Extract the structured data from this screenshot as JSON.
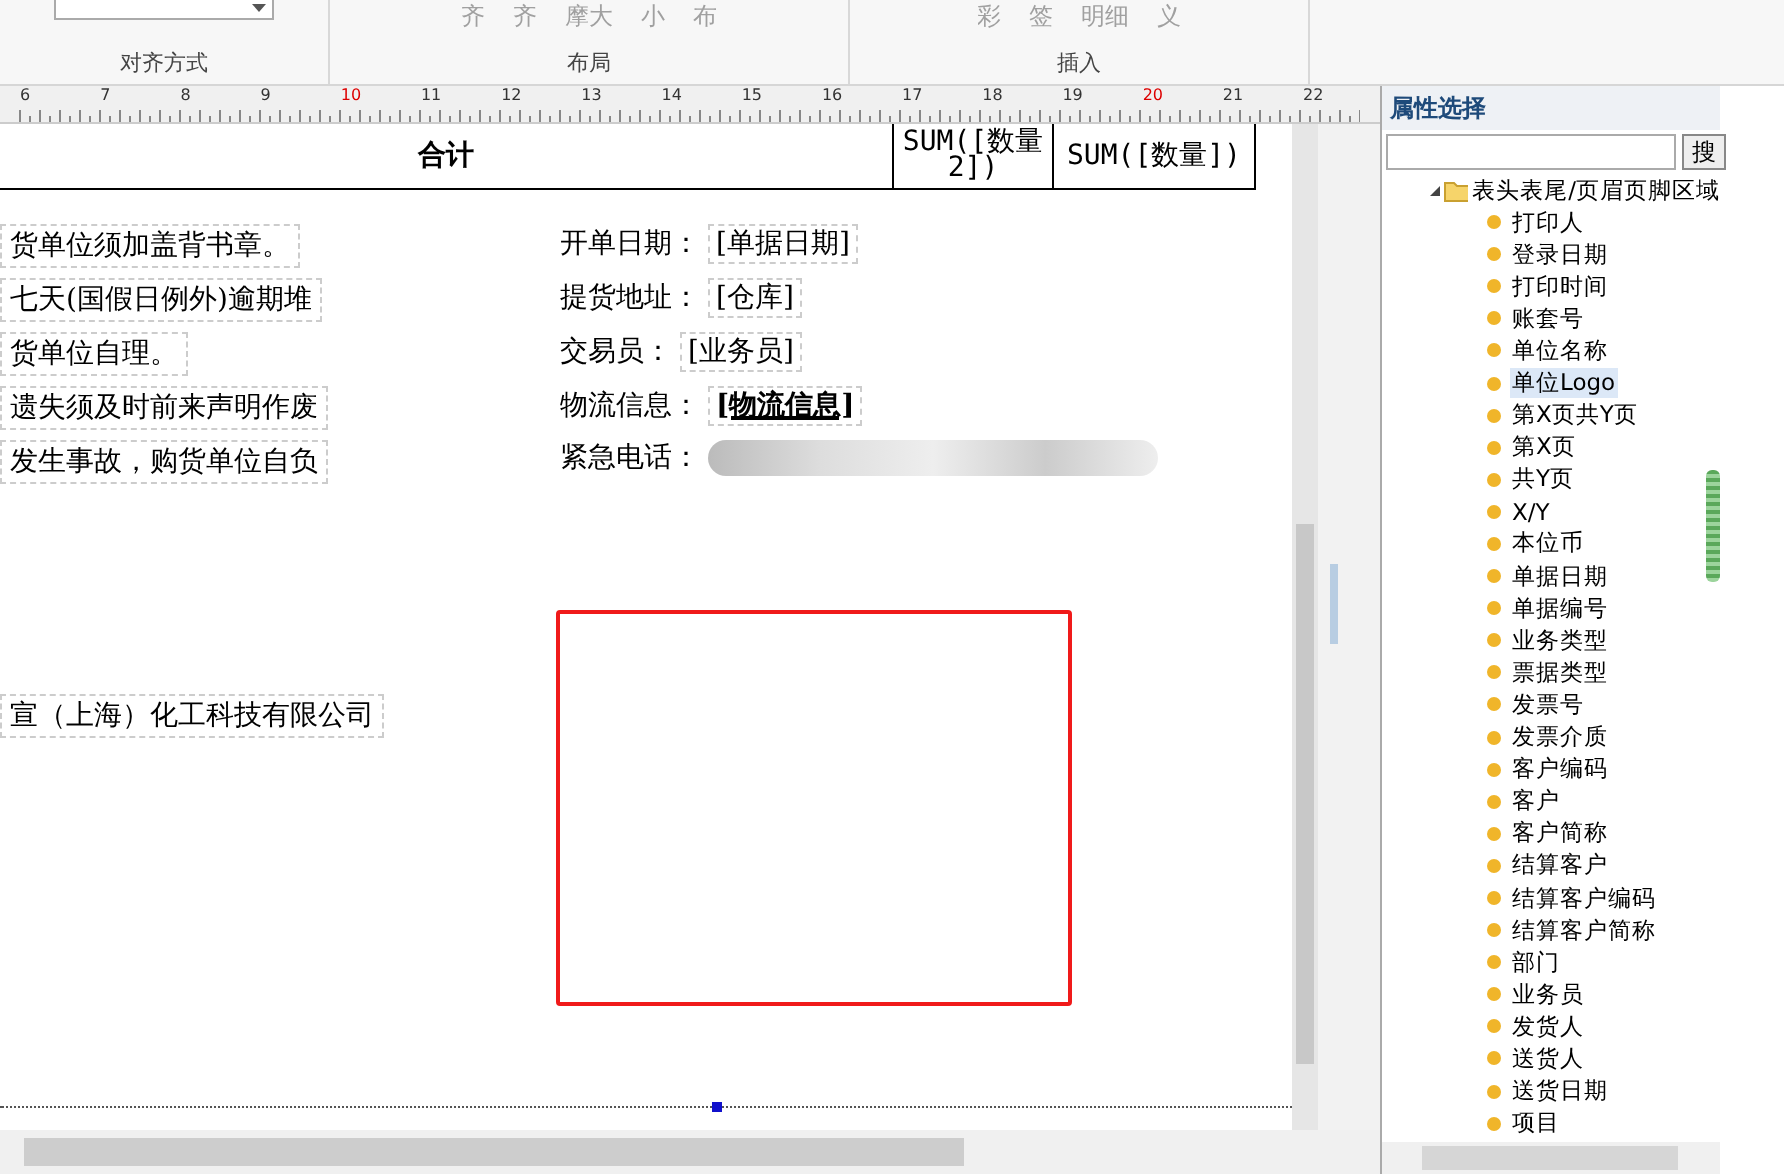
{
  "ribbon": {
    "groups": [
      {
        "label": "对齐方式",
        "kind": "dropdown"
      },
      {
        "label": "布局",
        "kind": "buttons",
        "fragments": [
          "齐",
          "齐",
          "摩大",
          "小",
          "布"
        ]
      },
      {
        "label": "插入",
        "kind": "buttons",
        "fragments": [
          "彩",
          "签",
          "明细",
          "义"
        ]
      }
    ]
  },
  "ruler": {
    "ticks": [
      {
        "label": "6",
        "marked": false
      },
      {
        "label": "7",
        "marked": false
      },
      {
        "label": "8",
        "marked": false
      },
      {
        "label": "9",
        "marked": false
      },
      {
        "label": "10",
        "marked": true
      },
      {
        "label": "11",
        "marked": false
      },
      {
        "label": "12",
        "marked": false
      },
      {
        "label": "13",
        "marked": false
      },
      {
        "label": "14",
        "marked": false
      },
      {
        "label": "15",
        "marked": false
      },
      {
        "label": "16",
        "marked": false
      },
      {
        "label": "17",
        "marked": false
      },
      {
        "label": "18",
        "marked": false
      },
      {
        "label": "19",
        "marked": false
      },
      {
        "label": "20",
        "marked": true
      },
      {
        "label": "21",
        "marked": false
      },
      {
        "label": "22",
        "marked": false
      }
    ]
  },
  "total_row": {
    "label": "合计",
    "cells": [
      "SUM([数量2])",
      "SUM([数量])"
    ]
  },
  "notes": [
    "货单位须加盖背书章。",
    "七天(国假日例外)逾期堆",
    "货单位自理。",
    "遗失须及时前来声明作废",
    "发生事故，购货单位自负"
  ],
  "fields": [
    {
      "kind": "text",
      "label": "开单日期：",
      "value": "[单据日期]",
      "underlined": false
    },
    {
      "kind": "text",
      "label": "提货地址：",
      "value": "[仓库]",
      "underlined": false
    },
    {
      "kind": "text",
      "label": "交易员：",
      "value": "[业务员]",
      "underlined": false
    },
    {
      "kind": "text",
      "label": "物流信息：",
      "value": "[物流信息]",
      "underlined": true
    },
    {
      "kind": "blurred",
      "label": "紧急电话："
    }
  ],
  "company": "宣（上海）化工科技有限公司",
  "panel": {
    "title": "属性选择",
    "search_button": "搜",
    "tree": {
      "label": "表头表尾/页眉页脚区域",
      "expanded": true,
      "children": [
        {
          "label": "打印人",
          "selected": false
        },
        {
          "label": "登录日期",
          "selected": false
        },
        {
          "label": "打印时间",
          "selected": false
        },
        {
          "label": "账套号",
          "selected": false
        },
        {
          "label": "单位名称",
          "selected": false
        },
        {
          "label": "单位Logo",
          "selected": true
        },
        {
          "label": "第X页共Y页",
          "selected": false
        },
        {
          "label": "第X页",
          "selected": false
        },
        {
          "label": "共Y页",
          "selected": false
        },
        {
          "label": "X/Y",
          "selected": false
        },
        {
          "label": "本位币",
          "selected": false
        },
        {
          "label": "单据日期",
          "selected": false
        },
        {
          "label": "单据编号",
          "selected": false
        },
        {
          "label": "业务类型",
          "selected": false
        },
        {
          "label": "票据类型",
          "selected": false
        },
        {
          "label": "发票号",
          "selected": false
        },
        {
          "label": "发票介质",
          "selected": false
        },
        {
          "label": "客户编码",
          "selected": false
        },
        {
          "label": "客户",
          "selected": false
        },
        {
          "label": "客户简称",
          "selected": false
        },
        {
          "label": "结算客户",
          "selected": false
        },
        {
          "label": "结算客户编码",
          "selected": false
        },
        {
          "label": "结算客户简称",
          "selected": false
        },
        {
          "label": "部门",
          "selected": false
        },
        {
          "label": "业务员",
          "selected": false
        },
        {
          "label": "发货人",
          "selected": false
        },
        {
          "label": "送货人",
          "selected": false
        },
        {
          "label": "送货日期",
          "selected": false
        },
        {
          "label": "项目",
          "selected": false
        }
      ]
    }
  }
}
